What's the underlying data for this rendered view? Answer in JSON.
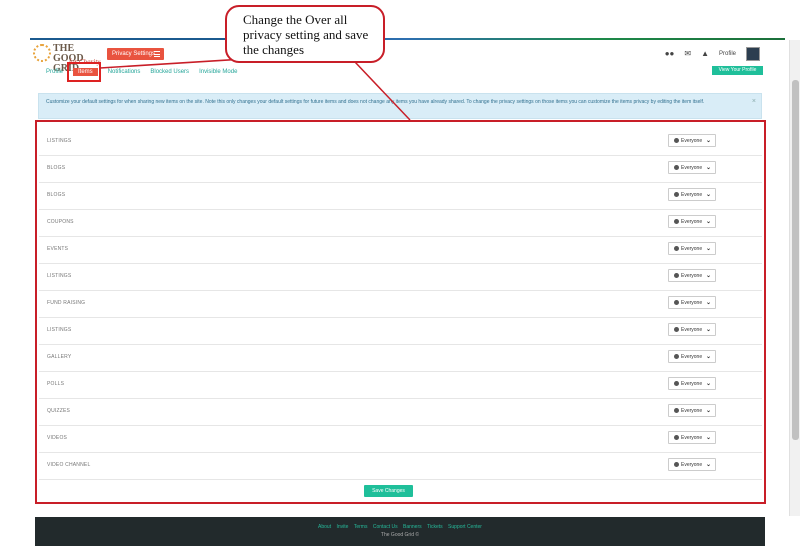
{
  "header": {
    "logo_text": "THE GOOD GRID",
    "logo_sub": "for Charity",
    "privacy_button": "Privacy Settings",
    "profile_label": "Profile",
    "icons": [
      "users-icon",
      "envelope-icon",
      "bell-icon"
    ]
  },
  "tabs": [
    {
      "label": "Profile"
    },
    {
      "label": "Items",
      "active": true
    },
    {
      "label": "Notifications"
    },
    {
      "label": "Blocked Users"
    },
    {
      "label": "Invisible Mode"
    }
  ],
  "view_profile": "View Your Profile",
  "info": "Customize your default settings for when sharing new items on the site. Note this only changes your default settings for future items and does not change any items you have already shared. To change the privacy settings on those items you can customize the items privacy by editing the item itself.",
  "rows": [
    {
      "label": "LISTINGS",
      "value": "Everyone"
    },
    {
      "label": "BLOGS",
      "value": "Everyone"
    },
    {
      "label": "BLOGS",
      "value": "Everyone"
    },
    {
      "label": "COUPONS",
      "value": "Everyone"
    },
    {
      "label": "EVENTS",
      "value": "Everyone"
    },
    {
      "label": "LISTINGS",
      "value": "Everyone"
    },
    {
      "label": "FUND RAISING",
      "value": "Everyone"
    },
    {
      "label": "LISTINGS",
      "value": "Everyone"
    },
    {
      "label": "GALLERY",
      "value": "Everyone"
    },
    {
      "label": "POLLS",
      "value": "Everyone"
    },
    {
      "label": "QUIZZES",
      "value": "Everyone"
    },
    {
      "label": "VIDEOS",
      "value": "Everyone"
    },
    {
      "label": "VIDEO CHANNEL",
      "value": "Everyone"
    }
  ],
  "save_button": "Save Changes",
  "footer": {
    "links": [
      "About",
      "Invite",
      "Terms",
      "Contact Us",
      "Banners",
      "Tickets",
      "Support Center"
    ],
    "copyright": "The Good Grid ©"
  },
  "callout": "Change the Over all privacy setting and save the changes"
}
